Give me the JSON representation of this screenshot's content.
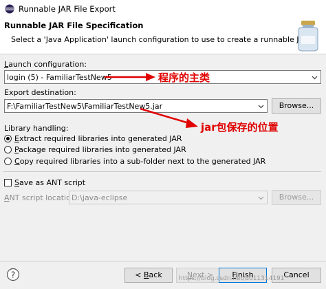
{
  "window": {
    "title": "Runnable JAR File Export"
  },
  "banner": {
    "heading": "Runnable JAR File Specification",
    "description": "Select a 'Java Application' launch configuration to use to create a runnable JAR."
  },
  "launch": {
    "label": "Launch configuration:",
    "label_mnemonic": "L",
    "label_rest": "aunch configuration:",
    "value": "login (5) - FamiliarTestNew5"
  },
  "export": {
    "label": "Export destination:",
    "value": "F:\\FamiliarTestNew5\\FamiliarTestNew5.jar",
    "browse_label": "Browse..."
  },
  "library": {
    "label": "Library handling:",
    "options": [
      {
        "mnemonic": "E",
        "rest": "xtract required libraries into generated JAR",
        "checked": true
      },
      {
        "mnemonic": "P",
        "rest": "ackage required libraries into generated JAR",
        "checked": false
      },
      {
        "mnemonic": "C",
        "rest": "opy required libraries into a sub-folder next to the generated JAR",
        "checked": false
      }
    ]
  },
  "ant": {
    "checkbox_mnemonic": "S",
    "checkbox_rest": "ave as ANT script",
    "checked": false,
    "location_mnemonic": "A",
    "location_rest": "NT script location:",
    "location_value": "D:\\java-eclipse",
    "browse_label": "Browse..."
  },
  "annotations": {
    "main_class": "程序的主类",
    "jar_location": "jar包保存的位置",
    "color": "#e00000"
  },
  "footer": {
    "back_prefix": "< ",
    "back_mnemonic": "B",
    "back_rest": "ack",
    "next_mnemonic": "N",
    "next_rest": "ext >",
    "finish_mnemonic": "F",
    "finish_rest": "inish",
    "cancel_label": "Cancel",
    "watermark": "https://blog.csdn.net/u011314191"
  }
}
